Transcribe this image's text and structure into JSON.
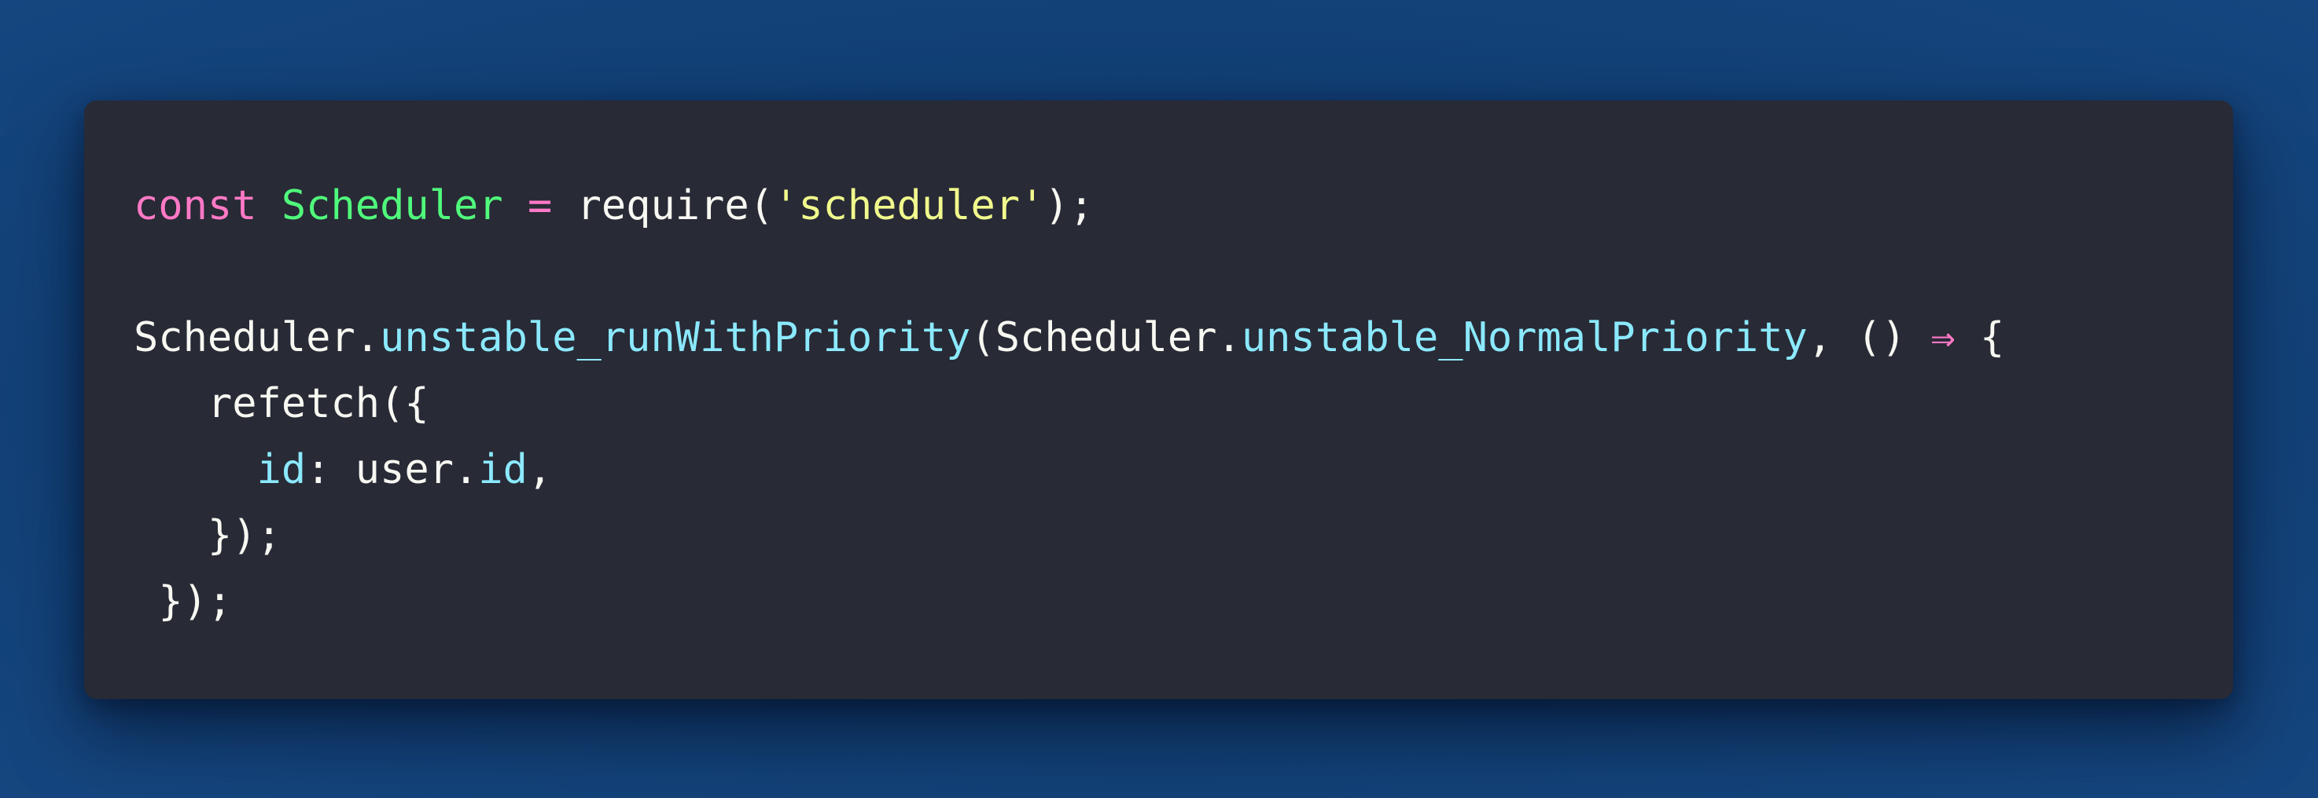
{
  "code": {
    "line1": {
      "kw_const": "const",
      "ident": "Scheduler",
      "op": "=",
      "fn": "require(",
      "str": "'scheduler'",
      "end": ");"
    },
    "line3": {
      "obj": "Scheduler.",
      "method": "unstable_runWithPriority",
      "paren": "(Scheduler.",
      "priority": "unstable_NormalPriority",
      "args": ", () ",
      "arrow": "⇒",
      "brace": " {"
    },
    "line4": {
      "call": "refetch({"
    },
    "line5": {
      "key": "id",
      "colon": ": user.",
      "value": "id",
      "comma": ","
    },
    "line6": {
      "close": "});"
    },
    "line7": {
      "close": "});"
    }
  },
  "colors": {
    "background": "#113f74",
    "editor": "#282a36",
    "keyword": "#ff79c6",
    "identifier": "#50fa7b",
    "string": "#f1fa8c",
    "property": "#8be9fd",
    "text": "#f8f8f2"
  }
}
